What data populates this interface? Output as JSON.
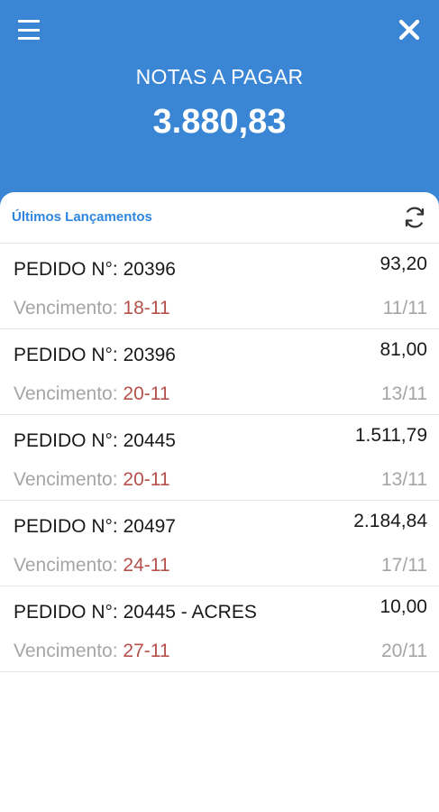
{
  "header": {
    "title": "NOTAS A PAGAR",
    "total": "3.880,83"
  },
  "icons": {
    "menu": "menu-icon",
    "close": "close-icon",
    "refresh": "refresh-icon"
  },
  "colors": {
    "header_bg": "#3a86d4",
    "accent": "#2e86de",
    "due_date": "#b5504b",
    "muted": "#a5a5a5"
  },
  "list": {
    "title": "Últimos Lançamentos",
    "due_label": "Vencimento: ",
    "items": [
      {
        "order": "PEDIDO N°: 20396",
        "amount": "93,20",
        "due": "18-11",
        "date": "11/11"
      },
      {
        "order": "PEDIDO N°: 20396",
        "amount": "81,00",
        "due": "20-11",
        "date": "13/11"
      },
      {
        "order": "PEDIDO N°: 20445",
        "amount": "1.511,79",
        "due": "20-11",
        "date": "13/11"
      },
      {
        "order": "PEDIDO N°: 20497",
        "amount": "2.184,84",
        "due": "24-11",
        "date": "17/11"
      },
      {
        "order": "PEDIDO N°: 20445 - ACRES",
        "amount": "10,00",
        "due": "27-11",
        "date": "20/11"
      }
    ]
  }
}
